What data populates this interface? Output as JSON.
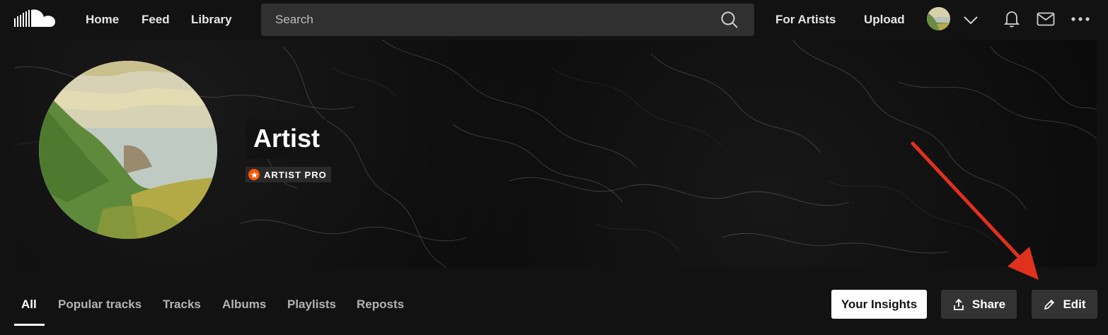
{
  "nav": {
    "logo": "soundcloud-logo",
    "links": [
      "Home",
      "Feed",
      "Library"
    ],
    "search_placeholder": "Search",
    "for_artists": "For Artists",
    "upload": "Upload"
  },
  "profile": {
    "name": "Artist",
    "badge": "ARTIST PRO"
  },
  "tabs": [
    "All",
    "Popular tracks",
    "Tracks",
    "Albums",
    "Playlists",
    "Reposts"
  ],
  "active_tab": "All",
  "actions": {
    "insights": "Your Insights",
    "share": "Share",
    "edit": "Edit"
  },
  "colors": {
    "brand": "#ff5500",
    "annotation_arrow": "#e0301e",
    "background": "#121212"
  },
  "icons": [
    "soundcloud-logo",
    "search-icon",
    "chevron-down-icon",
    "bell-icon",
    "mail-icon",
    "more-icon",
    "star-icon",
    "share-icon",
    "pencil-icon"
  ]
}
